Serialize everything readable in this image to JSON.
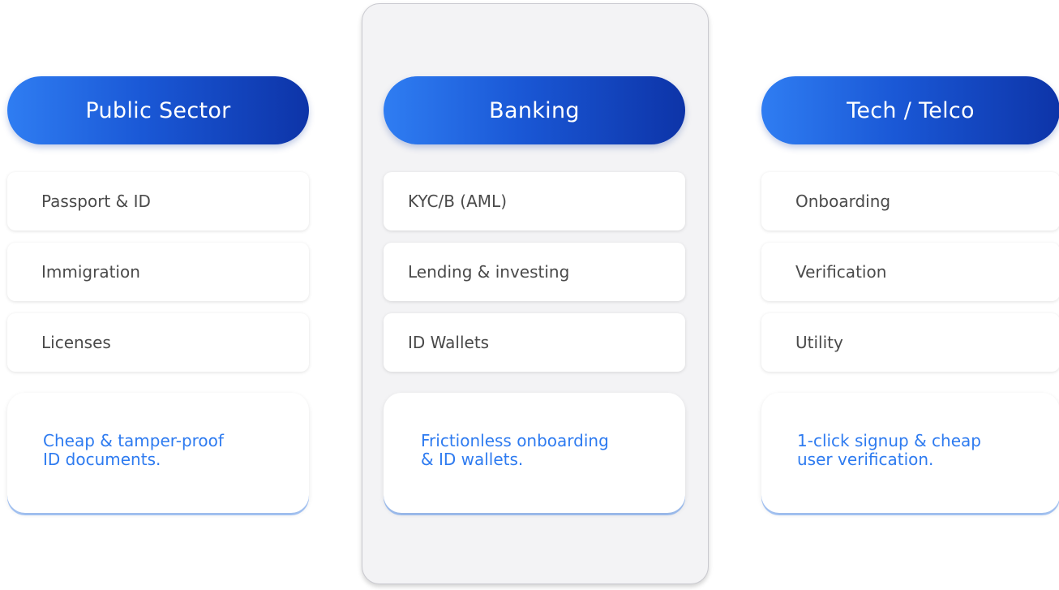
{
  "columns": [
    {
      "title": "Public Sector",
      "items": [
        "Passport & ID",
        "Immigration",
        "Licenses"
      ],
      "summary": "Cheap & tamper-proof\nID documents."
    },
    {
      "title": "Banking",
      "items": [
        "KYC/B (AML)",
        "Lending & investing",
        "ID Wallets"
      ],
      "summary": "Frictionless onboarding\n& ID wallets."
    },
    {
      "title": "Tech / Telco",
      "items": [
        "Onboarding",
        "Verification",
        "Utility"
      ],
      "summary": "1-click signup & cheap\nuser verification."
    }
  ],
  "colors": {
    "pill_gradient_start": "#2f7df2",
    "pill_gradient_end": "#0d34a8",
    "summary_text": "#2e7bf0",
    "item_text": "#4a4a4a",
    "highlight_panel": "#f3f3f5"
  }
}
